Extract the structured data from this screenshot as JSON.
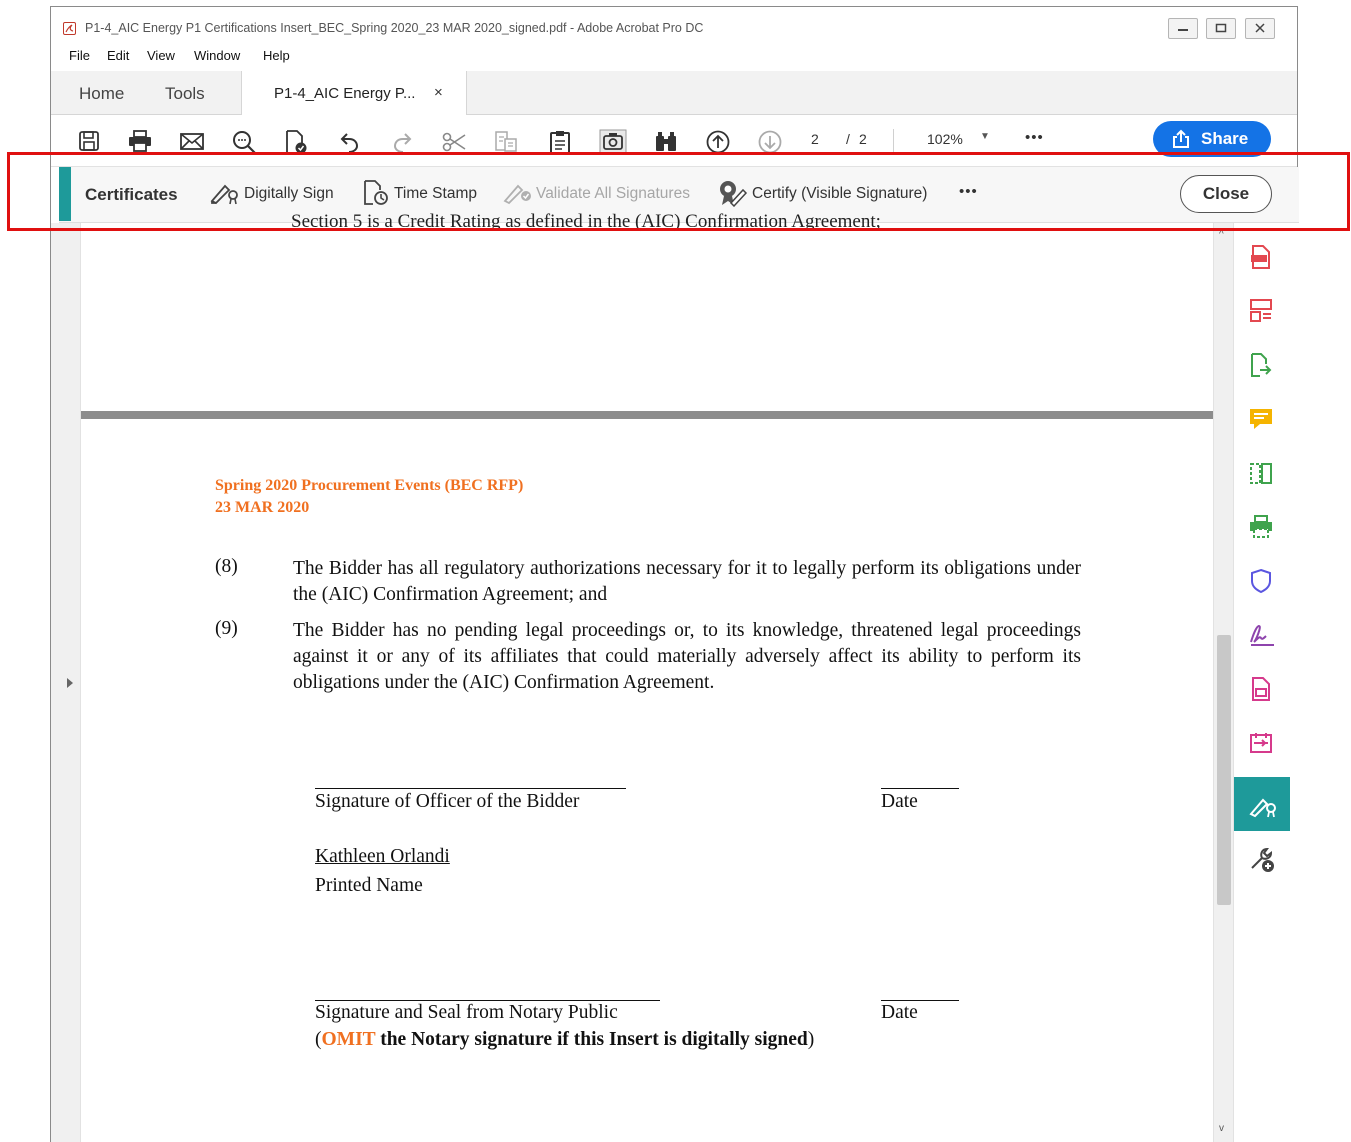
{
  "window": {
    "title": "P1-4_AIC Energy P1 Certifications Insert_BEC_Spring 2020_23 MAR 2020_signed.pdf - Adobe Acrobat Pro DC"
  },
  "menu": [
    "File",
    "Edit",
    "View",
    "Window",
    "Help"
  ],
  "tabs": {
    "home": "Home",
    "tools": "Tools",
    "document": "P1-4_AIC Energy P...",
    "document_close": "×"
  },
  "toolbar": {
    "icons": [
      "save-icon",
      "print-icon",
      "email-icon",
      "search-icon",
      "export-pdf-icon",
      "undo-icon",
      "redo-icon",
      "cut-icon",
      "edit-text-icon",
      "clipboard-icon",
      "snapshot-icon",
      "find-icon",
      "page-up-icon",
      "page-down-icon"
    ],
    "page_current": "2",
    "page_separator": "/",
    "page_total": "2",
    "zoom": "102%",
    "zoom_caret": "▼",
    "more": "•••",
    "share_label": "Share"
  },
  "certificates_bar": {
    "title": "Certificates",
    "digitally_sign": "Digitally Sign",
    "time_stamp": "Time Stamp",
    "validate_all": "Validate All Signatures",
    "certify_visible": "Certify (Visible Signature)",
    "more": "•••",
    "close_label": "Close"
  },
  "document": {
    "previous_page_cutoff": "Section 5 is a Credit Rating as defined in the (AIC) Confirmation Agreement;",
    "header_line1": "Spring 2020 Procurement Events (BEC RFP)",
    "header_line2": "23 MAR 2020",
    "items": [
      {
        "num": "(8)",
        "text": "The Bidder has all regulatory authorizations necessary for it to legally perform its obligations under the (AIC) Confirmation Agreement; and"
      },
      {
        "num": "(9)",
        "text": "The Bidder has no pending legal proceedings or, to its knowledge, threatened legal proceedings against it or any of its affiliates that could materially adversely affect its ability to perform its obligations under the (AIC) Confirmation Agreement."
      }
    ],
    "officer_signature_label": "Signature of Officer of the Bidder",
    "date_label": "Date",
    "printed_name_value": "Kathleen Orlandi",
    "printed_name_label": "Printed Name",
    "notary_signature_label": "Signature and Seal from Notary Public",
    "notary_date_label": "Date",
    "omit_open": "(",
    "omit_word": "OMIT",
    "omit_rest": " the Notary signature if this Insert is digitally signed",
    "omit_close": ")"
  },
  "right_rail": {
    "icons": [
      "create-pdf-icon",
      "organize-pages-icon",
      "export-pdf-icon",
      "comment-icon",
      "compare-icon",
      "print-production-icon",
      "protect-icon",
      "fill-sign-icon",
      "edit-pdf-icon",
      "combine-files-icon",
      "certificates-icon",
      "more-tools-icon"
    ],
    "colors": {
      "create": "#e34850",
      "organize": "#e34850",
      "export": "#3fa34d",
      "comment": "#f5b400",
      "compare": "#3fa34d",
      "print": "#3fa34d",
      "protect": "#5b56e0",
      "fill_sign": "#8e44ad",
      "edit": "#d63a8c",
      "combine": "#d63a8c",
      "active_bg": "#1e9a9a"
    }
  },
  "accent_colors": {
    "share_blue": "#1473e6",
    "cert_teal": "#1e9a9a",
    "highlight_red": "#e01010",
    "header_orange": "#f07020"
  }
}
